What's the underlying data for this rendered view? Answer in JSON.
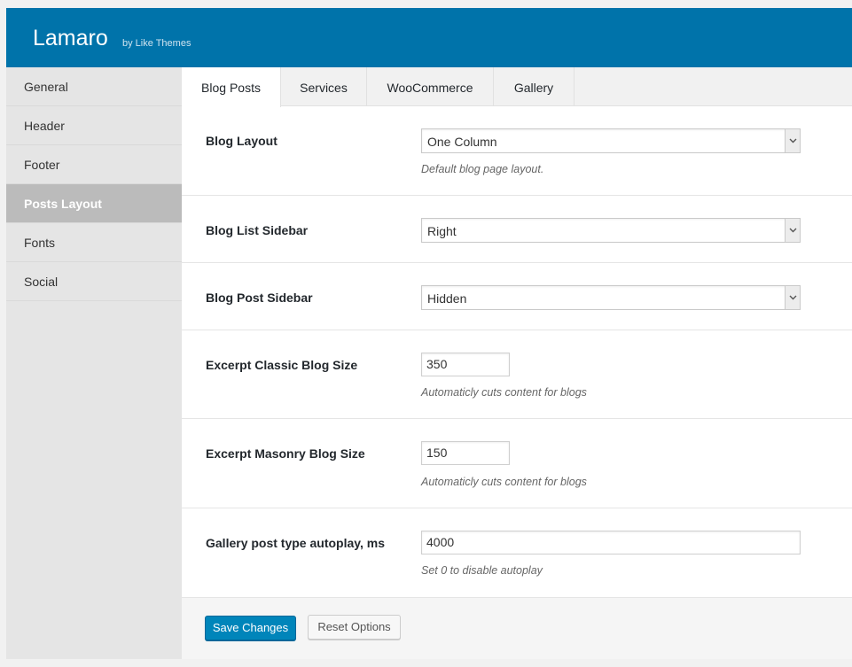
{
  "header": {
    "title": "Lamaro",
    "byline": "by Like Themes",
    "bg_color": "#0073aa"
  },
  "sidebar": {
    "items": [
      {
        "label": "General"
      },
      {
        "label": "Header"
      },
      {
        "label": "Footer"
      },
      {
        "label": "Posts Layout",
        "active": true
      },
      {
        "label": "Fonts"
      },
      {
        "label": "Social"
      }
    ]
  },
  "tabs": [
    {
      "label": "Blog Posts",
      "active": true
    },
    {
      "label": "Services"
    },
    {
      "label": "WooCommerce"
    },
    {
      "label": "Gallery"
    }
  ],
  "fields": {
    "blog_layout": {
      "label": "Blog Layout",
      "value": "One Column",
      "desc": "Default blog page layout."
    },
    "blog_list_sidebar": {
      "label": "Blog List Sidebar",
      "value": "Right"
    },
    "blog_post_sidebar": {
      "label": "Blog Post Sidebar",
      "value": "Hidden"
    },
    "excerpt_classic": {
      "label": "Excerpt Classic Blog Size",
      "value": "350",
      "desc": "Automaticly cuts content for blogs"
    },
    "excerpt_masonry": {
      "label": "Excerpt Masonry Blog Size",
      "value": "150",
      "desc": "Automaticly cuts content for blogs"
    },
    "gallery_autoplay": {
      "label": "Gallery post type autoplay, ms",
      "value": "4000",
      "desc": "Set 0 to disable autoplay"
    }
  },
  "buttons": {
    "save": "Save Changes",
    "reset": "Reset Options"
  },
  "icons": {
    "select_arrow": "chevron-down-icon"
  },
  "colors": {
    "primary_button": "#0085ba",
    "active_sidebar": "#bbbbbb"
  }
}
